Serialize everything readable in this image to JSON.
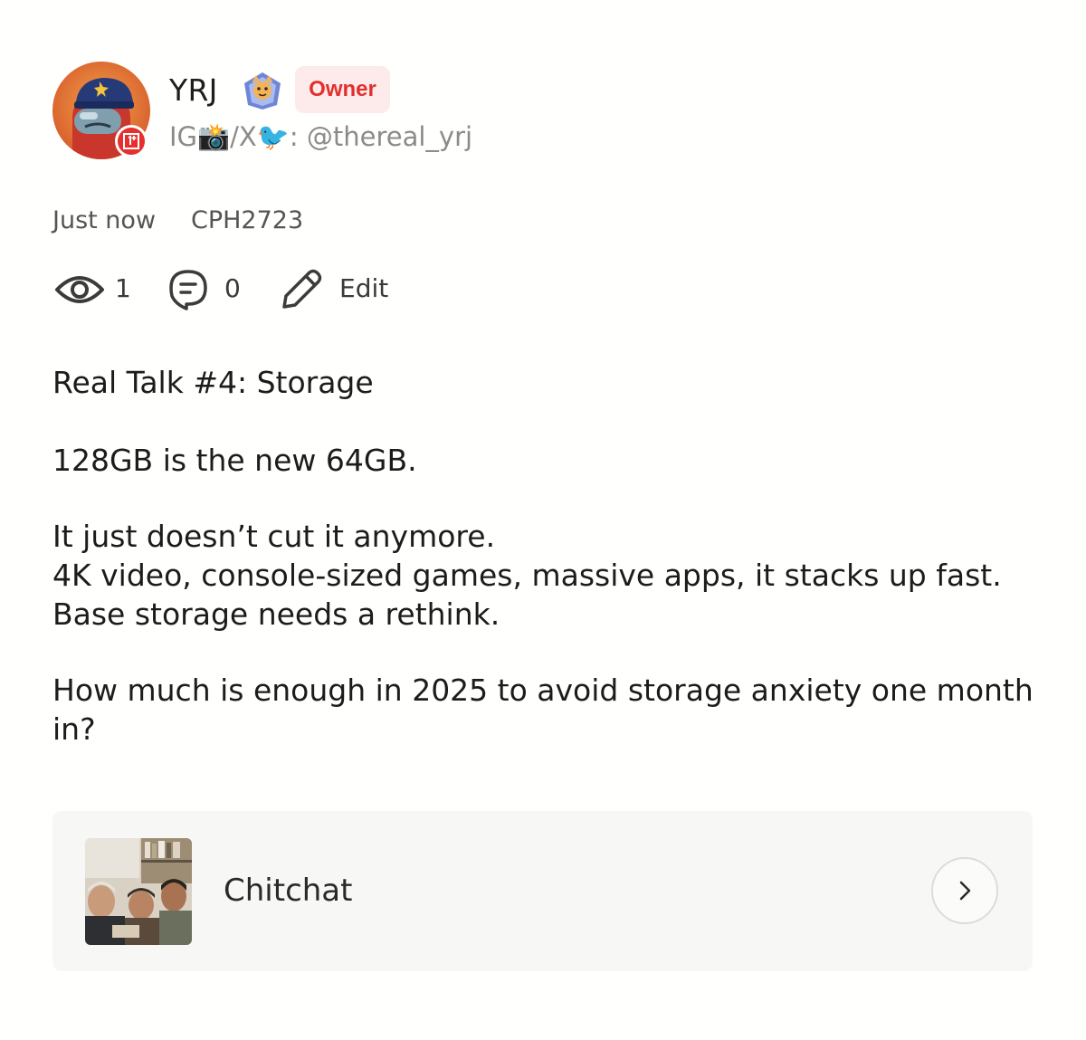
{
  "author": {
    "name": "YRJ",
    "role_badge": "Owner",
    "bio": "IG📸/X🐦: @thereal_yrj"
  },
  "meta": {
    "time": "Just now",
    "device": "CPH2723"
  },
  "stats": {
    "views": "1",
    "comments": "0",
    "edit_label": "Edit"
  },
  "post": {
    "title_line": "Real Talk #4: Storage",
    "lead": "128GB is the new 64GB.",
    "paragraph_lines": [
      "It just doesn’t cut it anymore.",
      "4K video, console-sized games, massive apps, it stacks up fast.",
      "Base storage needs a rethink."
    ],
    "question_lines": [
      "How much is enough in 2025 to avoid storage anxiety one month",
      "in?"
    ]
  },
  "community": {
    "name": "Chitchat"
  },
  "colors": {
    "accent_red": "#e2302e",
    "badge_bg": "#fdeaea",
    "text_muted": "#8b8b8b"
  },
  "icons": {
    "views": "eye-icon",
    "comments": "comment-bubble-icon",
    "edit": "pencil-icon",
    "card_arrow": "chevron-right-icon",
    "avatar_badge": "oneplus-logo-icon",
    "level": "level-badge-icon"
  }
}
